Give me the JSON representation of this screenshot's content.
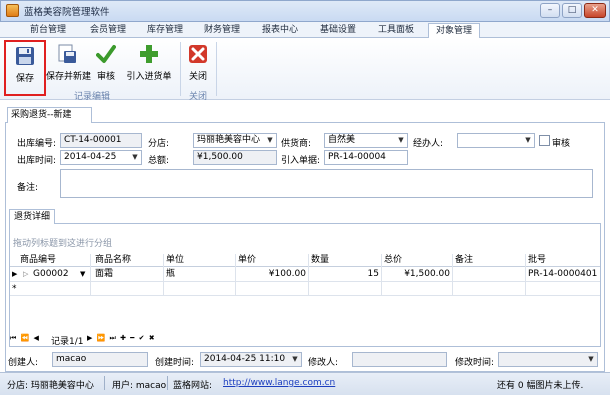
{
  "window": {
    "title": "蓝格美容院管理软件",
    "min": "–",
    "max": "□",
    "close": "✕"
  },
  "tabs": [
    "前台管理",
    "会员管理",
    "库存管理",
    "财务管理",
    "报表中心",
    "基础设置",
    "工具面板",
    "对象管理"
  ],
  "ribbon": {
    "save": "保存",
    "save_new": "保存并新建",
    "audit": "审核",
    "import": "引入进货单",
    "close": "关闭",
    "group_record": "记录编辑",
    "group_close": "关闭"
  },
  "doc_tab": "采购退货--新建",
  "form": {
    "out_no_label": "出库编号:",
    "out_no": "CT-14-00001",
    "store_label": "分店:",
    "store": "玛丽艳美容中心",
    "supplier_label": "供货商:",
    "supplier": "自然美",
    "handler_label": "经办人:",
    "handler": "",
    "audit_label": "审核",
    "out_time_label": "出库时间:",
    "out_time": "2014-04-25",
    "total_label": "总额:",
    "total": "¥1,500.00",
    "import_no_label": "引入单据:",
    "import_no": "PR-14-00004",
    "remark_label": "备注:",
    "remark": ""
  },
  "detail": {
    "tab": "退货详细",
    "group_hint": "拖动列标题到这进行分组",
    "headers": [
      "商品编号",
      "商品名称",
      "单位",
      "单价",
      "数量",
      "总价",
      "备注",
      "批号"
    ],
    "rows": [
      {
        "code": "G00002",
        "name": "面霜",
        "unit": "瓶",
        "price": "¥100.00",
        "qty": "15",
        "total": "¥1,500.00",
        "remark": "",
        "batch": "PR-14-0000401"
      }
    ],
    "new_row_marker": "*",
    "navigator": {
      "record": "记录1/1",
      "prev_icons": "⏮ ⏪ ◀",
      "next_icons": "▶ ⏩ ⏭ ✚ ━ ✔ ✖"
    }
  },
  "footer": {
    "creator_label": "创建人:",
    "creator": "macao",
    "create_time_label": "创建时间:",
    "create_time": "2014-04-25  11:10",
    "modifier_label": "修改人:",
    "modifier": "",
    "modify_time_label": "修改时间:",
    "modify_time": ""
  },
  "status": {
    "store": "分店: 玛丽艳美容中心",
    "user": "用户: macao",
    "site_label": "蓝格网站:",
    "site_url": "http://www.lange.com.cn",
    "upload": "还有 0 幅图片未上传."
  }
}
